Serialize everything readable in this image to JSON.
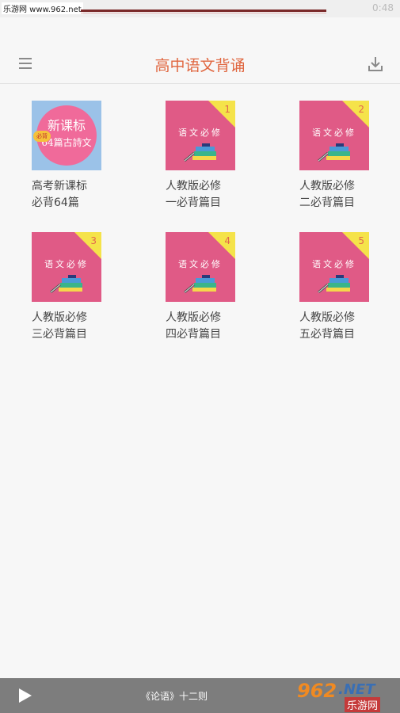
{
  "status_bar": {
    "watermark": "乐游网 www.962.net",
    "right_text": "0:48"
  },
  "app_bar": {
    "title": "高中语文背诵"
  },
  "items": [
    {
      "label_line1": "高考新课标",
      "label_line2": "必背64篇",
      "cover": {
        "line1": "新课标",
        "line2": "64篇古詩文",
        "tag": "必背"
      }
    },
    {
      "label_line1": "人教版必修",
      "label_line2": "一必背篇目",
      "number": "1",
      "book_title": "语文必修"
    },
    {
      "label_line1": "人教版必修",
      "label_line2": "二必背篇目",
      "number": "2",
      "book_title": "语文必修"
    },
    {
      "label_line1": "人教版必修",
      "label_line2": "三必背篇目",
      "number": "3",
      "book_title": "语文必修"
    },
    {
      "label_line1": "人教版必修",
      "label_line2": "四必背篇目",
      "number": "4",
      "book_title": "语文必修"
    },
    {
      "label_line1": "人教版必修",
      "label_line2": "五必背篇目",
      "number": "5",
      "book_title": "语文必修"
    }
  ],
  "player": {
    "now_playing": "《论语》十二则"
  },
  "watermark_bottom": {
    "big": "962",
    "net": ".NET",
    "cn": "乐游网"
  },
  "colors": {
    "accent": "#e0663f",
    "tile_pink": "#e05a86",
    "corner_yellow": "#f5e34a",
    "player_bg": "#7d7d7d"
  }
}
